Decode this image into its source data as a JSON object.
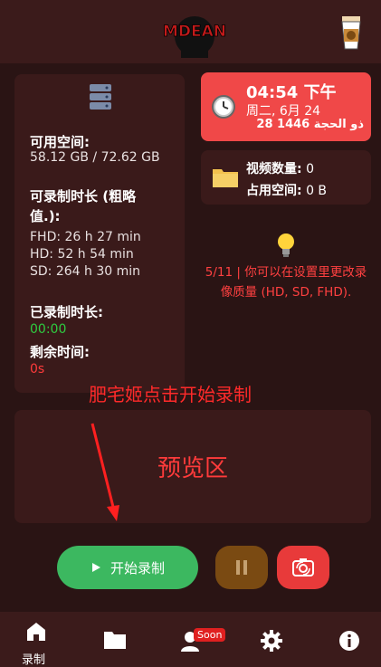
{
  "header": {
    "logo_text": "MDEAN",
    "coffee_icon": "coffee-cup-icon"
  },
  "storage": {
    "icon": "storage-icon",
    "available_label": "可用空间:",
    "available_value": "58.12 GB / 72.62 GB",
    "duration_label": "可录制时长 (粗略值.):",
    "fhd": "FHD: 26 h 27 min",
    "hd": "HD: 52 h 54 min",
    "sd": "SD: 264 h 30 min",
    "recorded_label": "已录制时长:",
    "recorded_value": "00:00",
    "remaining_label": "剩余时间:",
    "remaining_value": "0s"
  },
  "clock": {
    "time": "04:54 下午",
    "date": "周二, 6月 24",
    "hijri": "28 ذو الحجة 1446"
  },
  "videos": {
    "count_label": "视频数量:",
    "count_value": "0",
    "space_label": "占用空间:",
    "space_value": "0 B"
  },
  "tip": {
    "text": "5/11 | 你可以在设置里更改录像质量 (HD, SD, FHD)."
  },
  "hint": "肥宅姬点击开始录制",
  "preview": {
    "label": "预览区"
  },
  "controls": {
    "start_label": "开始录制"
  },
  "nav": {
    "home_label": "录制",
    "soon_badge": "Soon"
  },
  "colors": {
    "background": "#2a1414",
    "panel": "#3a1a1a",
    "accent_red": "#f04848",
    "start_green": "#3cb860",
    "pause_brown": "#7a4a12"
  }
}
